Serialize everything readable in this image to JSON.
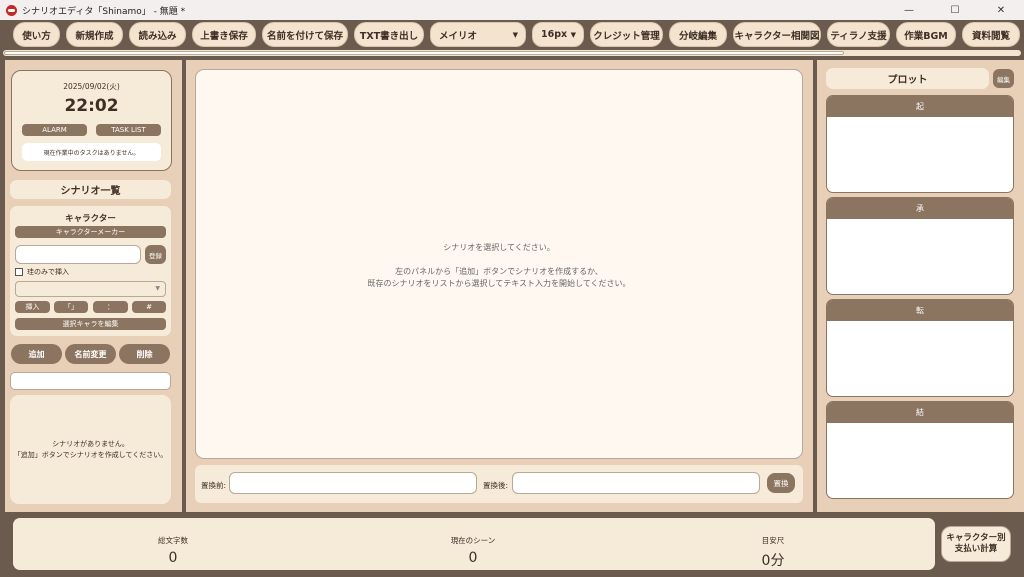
{
  "window": {
    "title": "シナリオエディタ「Shinamo」 - 無題 *",
    "controls": {
      "minimize": "—",
      "maximize": "☐",
      "close": "✕"
    }
  },
  "toolbar": {
    "usage": "使い方",
    "new": "新規作成",
    "load": "読み込み",
    "overwrite": "上書き保存",
    "save_as": "名前を付けて保存",
    "txt_export": "TXT書き出し",
    "font_select": "メイリオ",
    "size_select": "16px",
    "credits": "クレジット管理",
    "branch": "分岐編集",
    "relations": "キャラクター相関図",
    "tirano": "ティラノ支援",
    "bgm": "作業BGM",
    "materials": "資料閲覧"
  },
  "clock": {
    "date": "2025/09/02(火)",
    "time": "22:02",
    "alarm": "ALARM",
    "task_list": "TASK LIST",
    "task_status": "現在作業中のタスクはありません。"
  },
  "scenario_list": {
    "header": "シナリオ一覧",
    "add": "追加",
    "rename": "名前変更",
    "delete": "削除",
    "empty_line1": "シナリオがありません。",
    "empty_line2": "「追加」ボタンでシナリオを作成してください。"
  },
  "character": {
    "title": "キャラクター",
    "maker": "キャラクターメーカー",
    "register": "登録",
    "lines_only": "珪のみで挿入",
    "insert": "挿入",
    "bracket": "「」",
    "colon": "：",
    "hash": "#",
    "edit_selected": "選択キャラを編集"
  },
  "editor": {
    "prompt": "シナリオを選択してください。",
    "hint1": "左のパネルから「追加」ボタンでシナリオを作成するか、",
    "hint2": "既存のシナリオをリストから選択してテキスト入力を開始してください。"
  },
  "replace": {
    "before_label": "置換前:",
    "after_label": "置換後:",
    "button": "置換"
  },
  "plot": {
    "header": "プロット",
    "edit": "編集",
    "sections": [
      "起",
      "承",
      "転",
      "結"
    ]
  },
  "stats": {
    "total_chars_label": "総文字数",
    "total_chars": "0",
    "current_scene_label": "現在のシーン",
    "current_scene": "0",
    "estimate_label": "目安尺",
    "estimate": "0分",
    "pay_line1": "キャラクター別",
    "pay_line2": "支払い計算"
  }
}
